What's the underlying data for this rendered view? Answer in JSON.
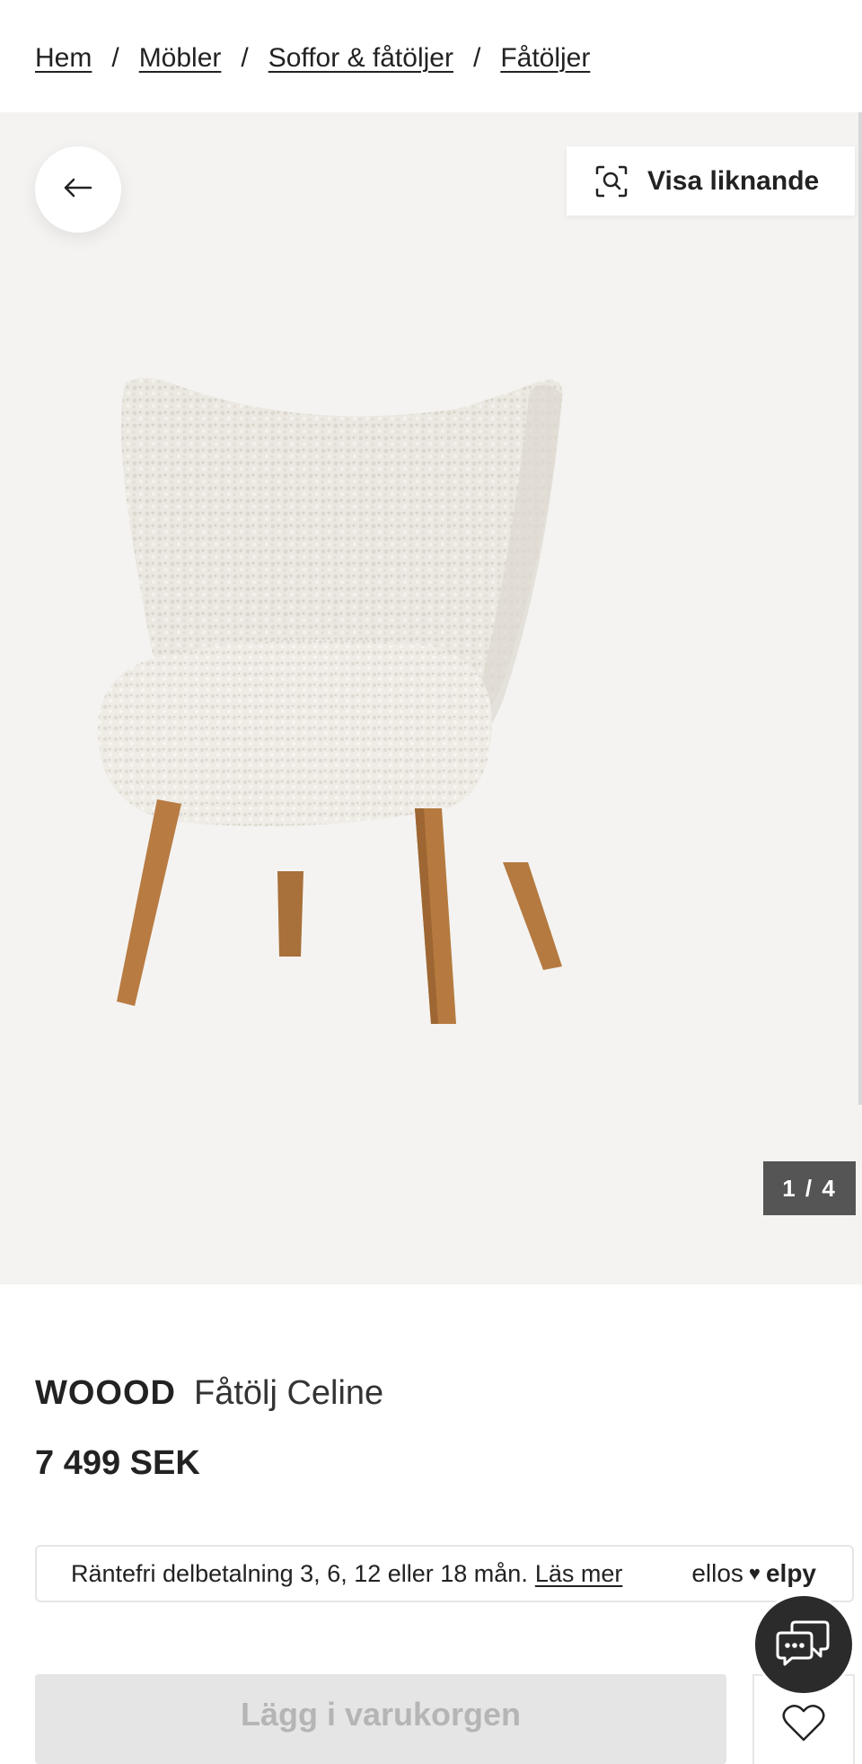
{
  "breadcrumb": {
    "items": [
      "Hem",
      "Möbler",
      "Soffor & fåtöljer",
      "Fåtöljer"
    ],
    "separator": "/"
  },
  "gallery": {
    "back_icon": "arrow-left-icon",
    "similar_icon": "visual-search-icon",
    "similar_label": "Visa liknande",
    "counter": "1 / 4"
  },
  "product": {
    "brand": "WOOOD",
    "name": "Fåtölj Celine",
    "price": "7 499 SEK"
  },
  "finance": {
    "text": "Räntefri delbetalning 3, 6, 12 eller 18 mån.",
    "link": "Läs mer",
    "logo_left": "ellos",
    "logo_right": "elpy"
  },
  "actions": {
    "add_to_cart": "Lägg i varukorgen",
    "favorite_icon": "heart-icon",
    "chat_icon": "chat-icon"
  },
  "colors": {
    "hero_bg": "#f4f3f1",
    "counter_bg": "#555555",
    "chat_bg": "#2b2b2b",
    "disabled_bg": "#e5e5e5"
  }
}
